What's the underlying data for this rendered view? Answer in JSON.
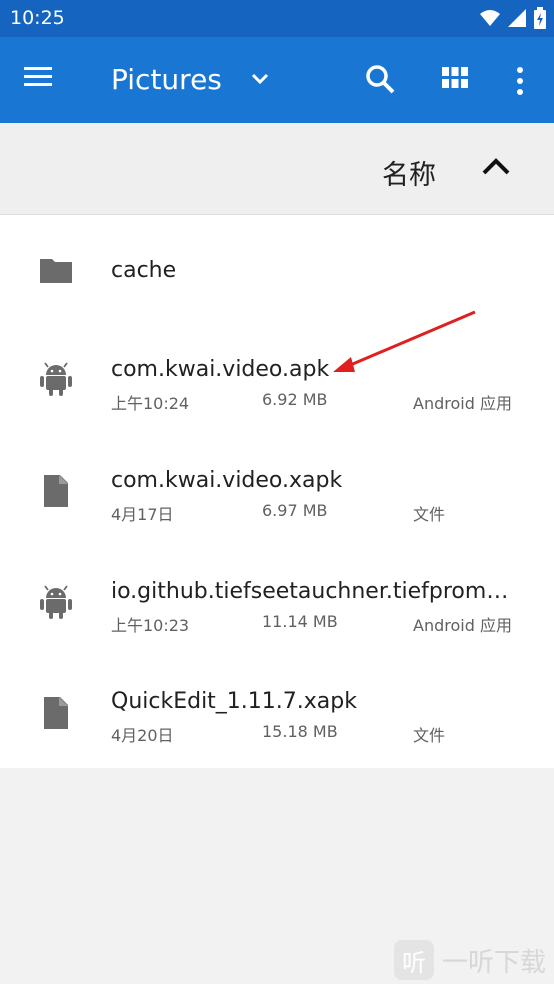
{
  "status_bar": {
    "time": "10:25",
    "icons": [
      "wifi-icon",
      "signal-icon",
      "battery-icon"
    ]
  },
  "app_bar": {
    "title": "Pictures",
    "icons": [
      "menu-icon",
      "chevron-down-icon",
      "search-icon",
      "grid-view-icon",
      "more-vert-icon"
    ],
    "color": "#1976d2"
  },
  "sort": {
    "label": "名称",
    "direction_icon": "chevron-up-icon"
  },
  "files": [
    {
      "name": "cache",
      "date": "",
      "size": "",
      "type": "",
      "icon": "folder-icon"
    },
    {
      "name": "com.kwai.video.apk",
      "date": "上午10:24",
      "size": "6.92 MB",
      "type": "Android 应用",
      "icon": "android-icon"
    },
    {
      "name": "com.kwai.video.xapk",
      "date": "4月17日",
      "size": "6.97 MB",
      "type": "文件",
      "icon": "file-icon"
    },
    {
      "name": "io.github.tiefseetauchner.tiefprompt…",
      "date": "上午10:23",
      "size": "11.14 MB",
      "type": "Android 应用",
      "icon": "android-icon"
    },
    {
      "name": "QuickEdit_1.11.7.xapk",
      "date": "4月20日",
      "size": "15.18 MB",
      "type": "文件",
      "icon": "file-icon"
    }
  ],
  "watermark": {
    "logo": "听",
    "text": "一听下载"
  },
  "annotation_color": "#e02020"
}
